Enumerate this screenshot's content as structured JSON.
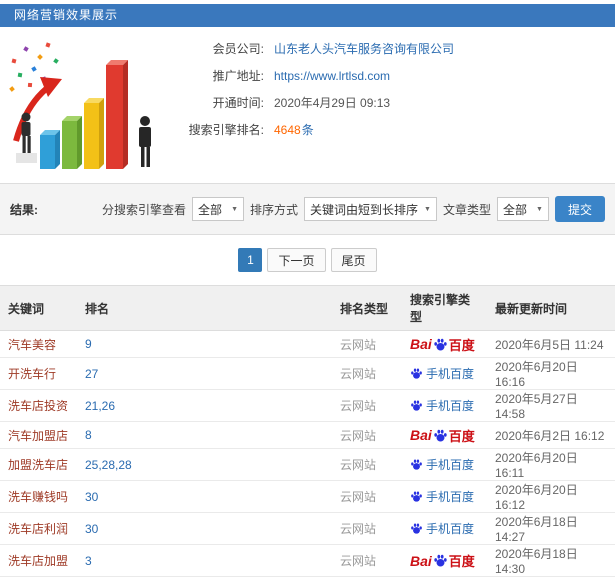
{
  "colors": {
    "accent": "#3a78bd",
    "link": "#2a6bb0",
    "highlight_orange": "#ff6600",
    "keyword_red": "#9e3a26",
    "baidu_blue": "#2932e1",
    "baidu_red": "#cc1016"
  },
  "icons": {
    "caret": "▼"
  },
  "header": {
    "title": "网络营销效果展示"
  },
  "info": {
    "company_label": "会员公司:",
    "company_value": "山东老人头汽车服务咨询有限公司",
    "url_label": "推广地址:",
    "url_value": "https://www.lrtlsd.com",
    "opened_label": "开通时间:",
    "opened_value": "2020年4月29日 09:13",
    "rank_label": "搜索引擎排名:",
    "rank_count": "4648",
    "rank_unit": "条"
  },
  "filters": {
    "result_label": "结果:",
    "engine_label": "分搜索引擎查看",
    "engine_value": "全部",
    "sort_label": "排序方式",
    "sort_value": "关键词由短到长排序",
    "type_label": "文章类型",
    "type_value": "全部",
    "submit_label": "提交"
  },
  "pagination": {
    "current": "1",
    "next_label": "下一页",
    "last_label": "尾页"
  },
  "table": {
    "headers": [
      "关键词",
      "排名",
      "排名类型",
      "搜索引擎类型",
      "最新更新时间"
    ],
    "engine_display": {
      "baidu": {
        "prefix": "Bai",
        "suffix": "百度",
        "icon": "baidu-paw-icon"
      },
      "mobile_baidu": {
        "label": "手机百度",
        "icon": "baidu-paw-icon"
      }
    },
    "rows": [
      {
        "keyword": "汽车美容",
        "rank": "9",
        "rank_type": "云网站",
        "engine": "baidu",
        "updated": "2020年6月5日 11:24"
      },
      {
        "keyword": "开洗车行",
        "rank": "27",
        "rank_type": "云网站",
        "engine": "mobile_baidu",
        "updated": "2020年6月20日 16:16"
      },
      {
        "keyword": "洗车店投资",
        "rank": "21,26",
        "rank_type": "云网站",
        "engine": "mobile_baidu",
        "updated": "2020年5月27日 14:58"
      },
      {
        "keyword": "汽车加盟店",
        "rank": "8",
        "rank_type": "云网站",
        "engine": "baidu",
        "updated": "2020年6月2日 16:12"
      },
      {
        "keyword": "加盟洗车店",
        "rank": "25,28,28",
        "rank_type": "云网站",
        "engine": "mobile_baidu",
        "updated": "2020年6月20日 16:11"
      },
      {
        "keyword": "洗车赚钱吗",
        "rank": "30",
        "rank_type": "云网站",
        "engine": "mobile_baidu",
        "updated": "2020年6月20日 16:12"
      },
      {
        "keyword": "洗车店利润",
        "rank": "30",
        "rank_type": "云网站",
        "engine": "mobile_baidu",
        "updated": "2020年6月18日 14:27"
      },
      {
        "keyword": "洗车店加盟",
        "rank": "3",
        "rank_type": "云网站",
        "engine": "baidu",
        "updated": "2020年6月18日 14:30"
      }
    ]
  }
}
